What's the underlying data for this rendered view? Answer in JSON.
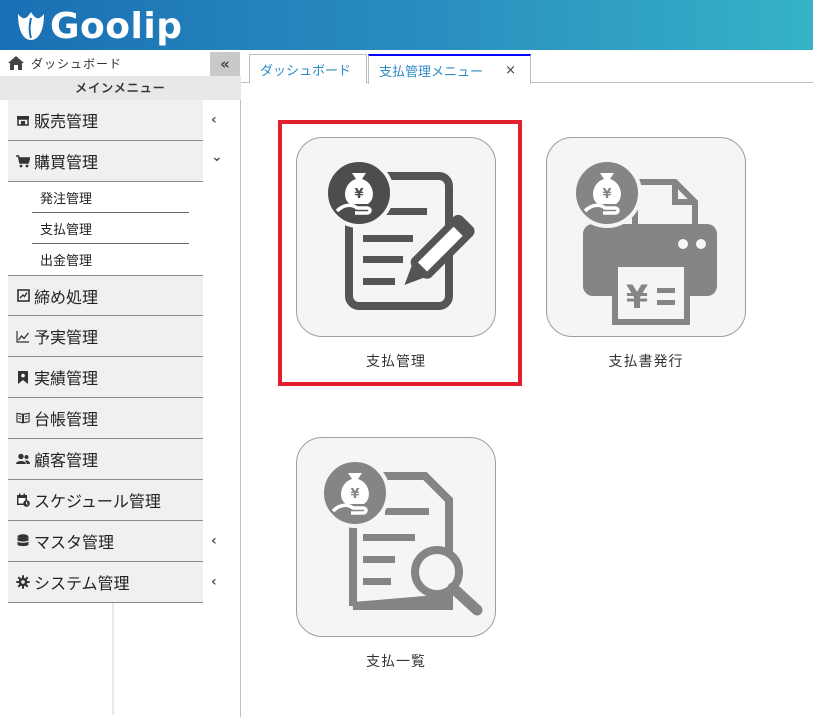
{
  "header": {
    "logo_text": "Goolip"
  },
  "sidebar": {
    "dashboard_label": "ダッシュボード",
    "collapse_icon": "«",
    "main_menu_label": "メインメニュー",
    "items": [
      {
        "label": "販売管理",
        "icon": "store-icon",
        "chevron": "‹"
      },
      {
        "label": "購買管理",
        "icon": "cart-icon",
        "chevron": "⌄"
      },
      {
        "label": "締め処理",
        "icon": "checkbox-icon",
        "chevron": ""
      },
      {
        "label": "予実管理",
        "icon": "line-chart-icon",
        "chevron": ""
      },
      {
        "label": "実績管理",
        "icon": "bookmark-icon",
        "chevron": ""
      },
      {
        "label": "台帳管理",
        "icon": "book-icon",
        "chevron": ""
      },
      {
        "label": "顧客管理",
        "icon": "users-icon",
        "chevron": ""
      },
      {
        "label": "スケジュール管理",
        "icon": "calendar-icon",
        "chevron": ""
      },
      {
        "label": "マスタ管理",
        "icon": "database-icon",
        "chevron": "‹"
      },
      {
        "label": "システム管理",
        "icon": "gear-icon",
        "chevron": "‹"
      }
    ],
    "submenu": [
      {
        "label": "発注管理"
      },
      {
        "label": "支払管理"
      },
      {
        "label": "出金管理"
      }
    ]
  },
  "tabs": [
    {
      "label": "ダッシュボード",
      "active": false
    },
    {
      "label": "支払管理メニュー",
      "active": true,
      "close": "×"
    }
  ],
  "tiles": [
    {
      "label": "支払管理",
      "icon": "payment-edit-icon",
      "highlighted": true
    },
    {
      "label": "支払書発行",
      "icon": "payment-print-icon",
      "highlighted": false
    },
    {
      "label": "支払一覧",
      "icon": "payment-search-icon",
      "highlighted": false
    }
  ],
  "colors": {
    "header_start": "#1a6fb4",
    "header_end": "#35b3c6",
    "highlight": "#e0202c",
    "tab_accent": "#2e8bc7",
    "icon_dark": "#555555",
    "icon_light": "#858585"
  }
}
